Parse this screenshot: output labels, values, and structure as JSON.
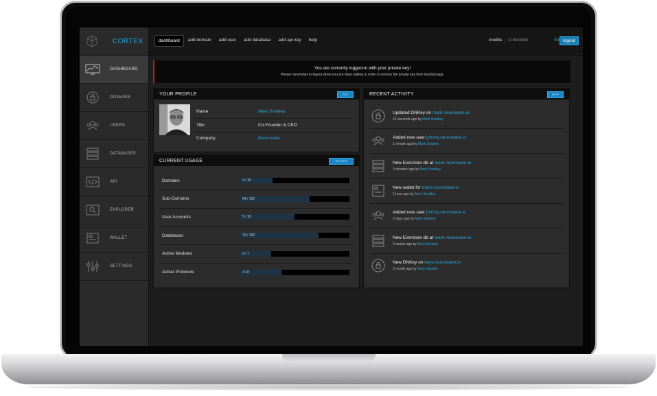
{
  "brand": {
    "name": "CORTEX"
  },
  "sidebar": {
    "items": [
      {
        "label": "DASHBOARD",
        "icon": "monitor-chart-icon",
        "active": true
      },
      {
        "label": "DOMAINS",
        "icon": "lock-icon"
      },
      {
        "label": "USERS",
        "icon": "users-icon"
      },
      {
        "label": "DATABASES",
        "icon": "database-icon"
      },
      {
        "label": "API",
        "icon": "code-icon"
      },
      {
        "label": "EXPLORER",
        "icon": "search-icon"
      },
      {
        "label": "WALLET",
        "icon": "wallet-icon"
      },
      {
        "label": "SETTINGS",
        "icon": "sliders-icon"
      }
    ]
  },
  "topbar": {
    "menu": [
      "dashboard",
      "add domain",
      "add user",
      "add database",
      "add api key",
      "help"
    ],
    "credits_label": "credits",
    "credits_value": "11.00000000",
    "flush": "flush",
    "logout": "logout"
  },
  "alert": {
    "title": "You are currently logged-in with your private key!",
    "message": "Please remember to logout when you are done editing in order to remove the private key from localStorage."
  },
  "profile": {
    "title": "YOUR PROFILE",
    "button": "EDIT",
    "rows": [
      {
        "key": "Name",
        "value": "Mark Smalley",
        "link": true
      },
      {
        "key": "Title",
        "value": "Co-Founder & CEO",
        "link": false
      },
      {
        "key": "Company",
        "value": "Neuroware",
        "link": true
      }
    ]
  },
  "usage": {
    "title": "CURRENT USAGE",
    "button": "REPORTS",
    "rows": [
      {
        "label": "Domains",
        "text": "3 / 10",
        "fraction": 0.3
      },
      {
        "label": "Sub-Domains",
        "text": "64 / 100",
        "fraction": 0.64
      },
      {
        "label": "User Accounts",
        "text": "5 / 10",
        "fraction": 0.5
      },
      {
        "label": "Databases",
        "text": "72 / 100",
        "fraction": 0.72
      },
      {
        "label": "Active Modules",
        "text": "2 / 7",
        "fraction": 0.29
      },
      {
        "label": "Active Protocols",
        "text": "3 / 8",
        "fraction": 0.38
      }
    ]
  },
  "activity": {
    "title": "RECENT ACTIVITY",
    "button": "MORE",
    "items": [
      {
        "icon": "lock-icon",
        "action": "Updated DNKey on",
        "target": "mark.neuroware.io",
        "time": "12 seconds ago by",
        "user": "Mark Smalley"
      },
      {
        "icon": "users-icon",
        "action": "Added new user",
        "target": "johnny.neuroware.io",
        "time": "1 minute ago by",
        "user": "Mark Smalley"
      },
      {
        "icon": "database-icon",
        "action": "New Everstore db at",
        "target": "team.neuroware.io",
        "time": "3 minutes ago by",
        "user": "Mark Smalley"
      },
      {
        "icon": "wallet-icon",
        "action": "New wallet for",
        "target": "mark.neuroware.io",
        "time": "1 hour ago by",
        "user": "Mark Smalley"
      },
      {
        "icon": "users-icon",
        "action": "Added new user",
        "target": "johnny.neuroware.io",
        "time": "2 days ago by",
        "user": "Mark Smalley"
      },
      {
        "icon": "database-icon",
        "action": "New Everstore db at",
        "target": "team.neuroware.io",
        "time": "3 weeks ago by",
        "user": "Mark Smalley"
      },
      {
        "icon": "lock-icon",
        "action": "New DNKey on",
        "target": "keys.neuroware.io",
        "time": "3 month ago by",
        "user": "Mark Smalley"
      }
    ]
  },
  "colors": {
    "accent": "#29a8df",
    "alert_border": "#b0201c",
    "button": "#1a86c4"
  }
}
